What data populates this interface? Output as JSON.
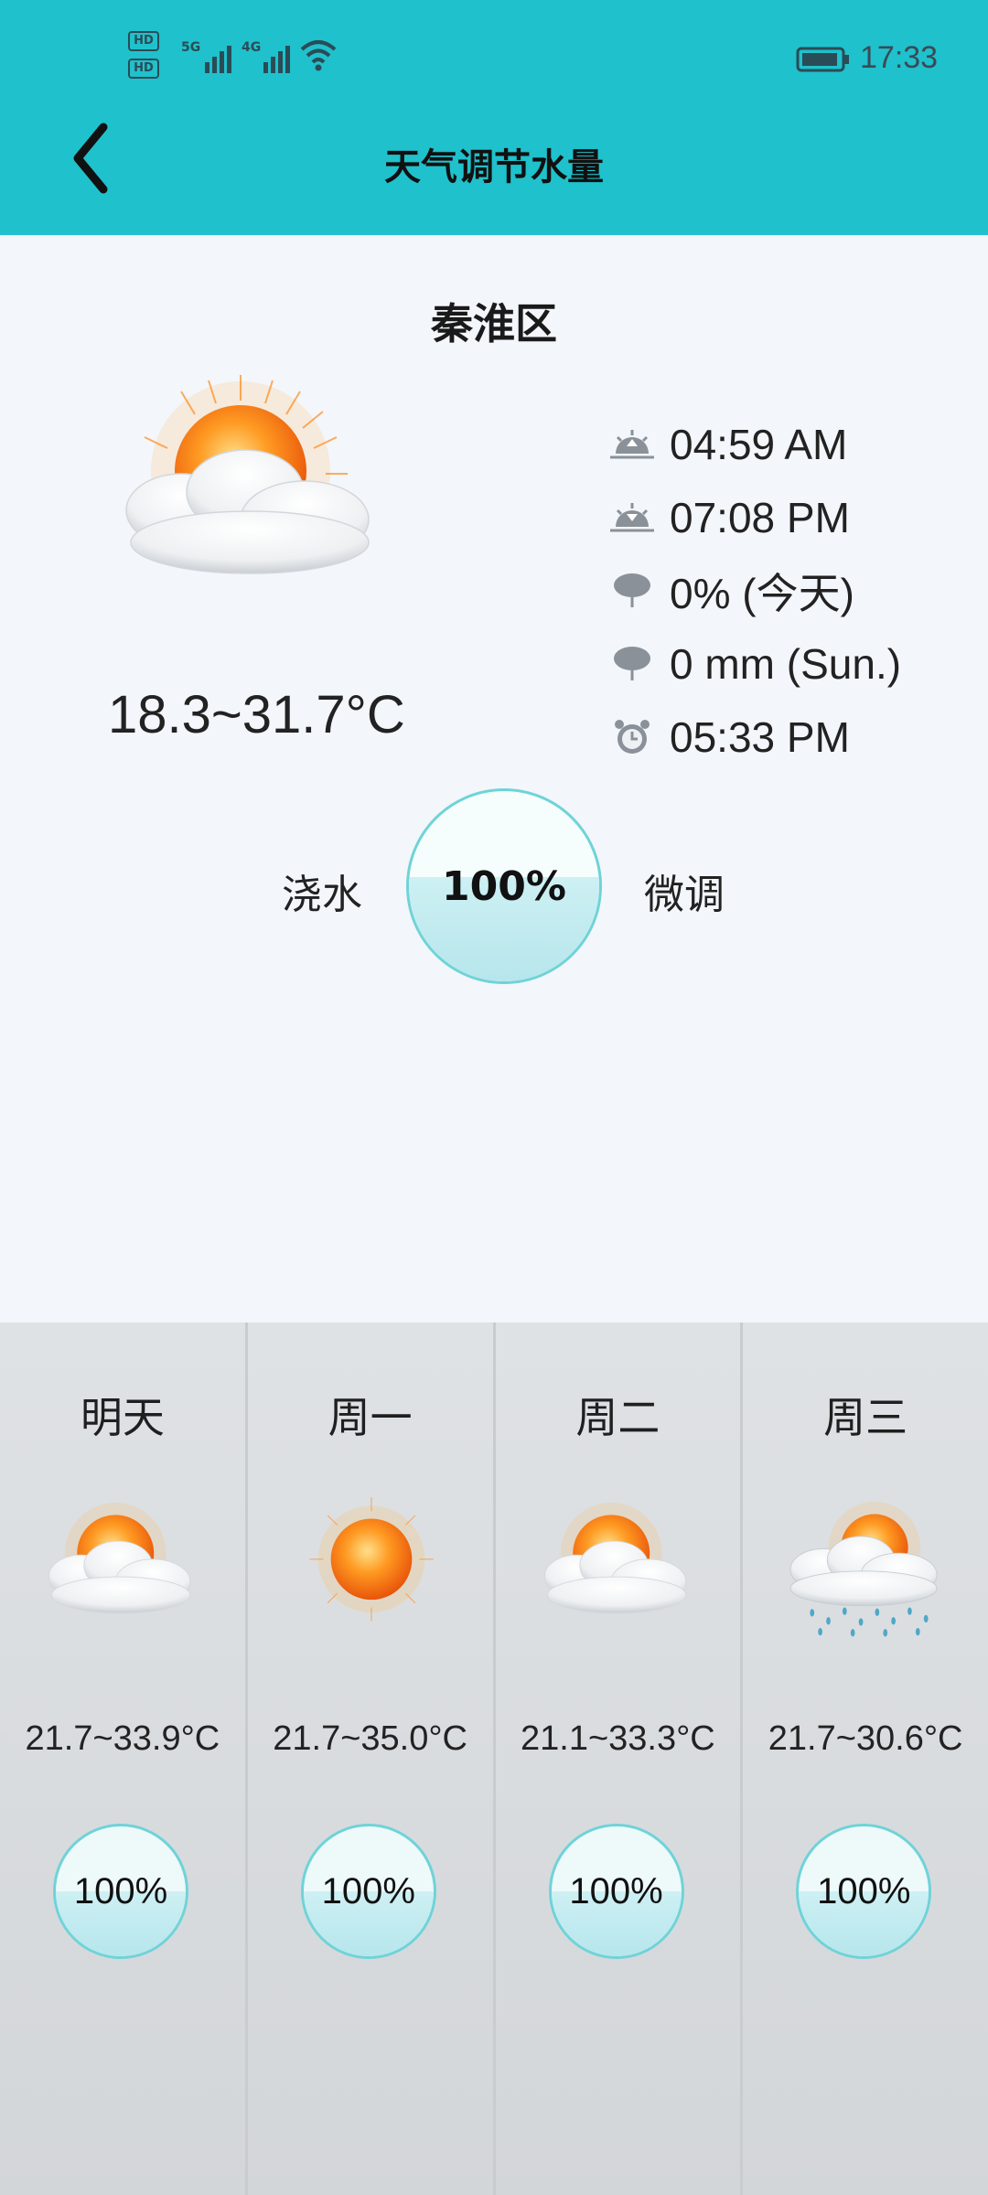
{
  "status_bar": {
    "hd1": "HD",
    "hd2": "HD",
    "signal1_label": "5G",
    "signal2_label": "4G",
    "time": "17:33"
  },
  "header": {
    "title": "天气调节水量",
    "accent_color": "#1fc1cc"
  },
  "main": {
    "district": "秦淮区",
    "weather_icon": "partly-cloudy-icon",
    "temp_range": "18.3~31.7°C",
    "info": {
      "sunrise": "04:59 AM",
      "sunset": "07:08 PM",
      "rain_chance": "0% (今天)",
      "rain_amount": "0 mm (Sun.)",
      "alarm": "05:33 PM"
    },
    "watering_label": "浇水",
    "adjust_label": "微调",
    "water_percent_text": "100%",
    "water_level": 1.0
  },
  "forecast": [
    {
      "day": "明天",
      "icon": "partly-cloudy-icon",
      "temp": "21.7~33.9°C",
      "percent": "100%",
      "level": 1.0
    },
    {
      "day": "周一",
      "icon": "sunny-icon",
      "temp": "21.7~35.0°C",
      "percent": "100%",
      "level": 1.0
    },
    {
      "day": "周二",
      "icon": "partly-cloudy-icon",
      "temp": "21.1~33.3°C",
      "percent": "100%",
      "level": 1.0
    },
    {
      "day": "周三",
      "icon": "rain-icon",
      "temp": "21.7~30.6°C",
      "percent": "100%",
      "level": 1.0
    }
  ]
}
